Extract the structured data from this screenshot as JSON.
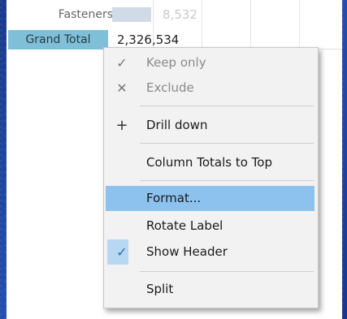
{
  "table": {
    "row1": {
      "label": "Fasteners",
      "value": "8,532"
    },
    "row2": {
      "label": "Grand Total",
      "value": "2,326,534"
    }
  },
  "context_menu": {
    "items": [
      {
        "label": "Keep only",
        "icon": "check-icon",
        "enabled": false
      },
      {
        "label": "Exclude",
        "icon": "x-icon",
        "enabled": false
      },
      {
        "label": "Drill down",
        "icon": "plus-icon",
        "enabled": true
      },
      {
        "label": "Column Totals to Top",
        "icon": "",
        "enabled": true
      },
      {
        "label": "Format...",
        "icon": "",
        "enabled": true,
        "highlighted": true
      },
      {
        "label": "Rotate Label",
        "icon": "",
        "enabled": true
      },
      {
        "label": "Show Header",
        "icon": "check-icon",
        "enabled": true,
        "checked": true
      },
      {
        "label": "Split",
        "icon": "",
        "enabled": true
      }
    ],
    "colors": {
      "highlight": "#8ec2ee",
      "header_fill": "#7fc0d8"
    }
  }
}
